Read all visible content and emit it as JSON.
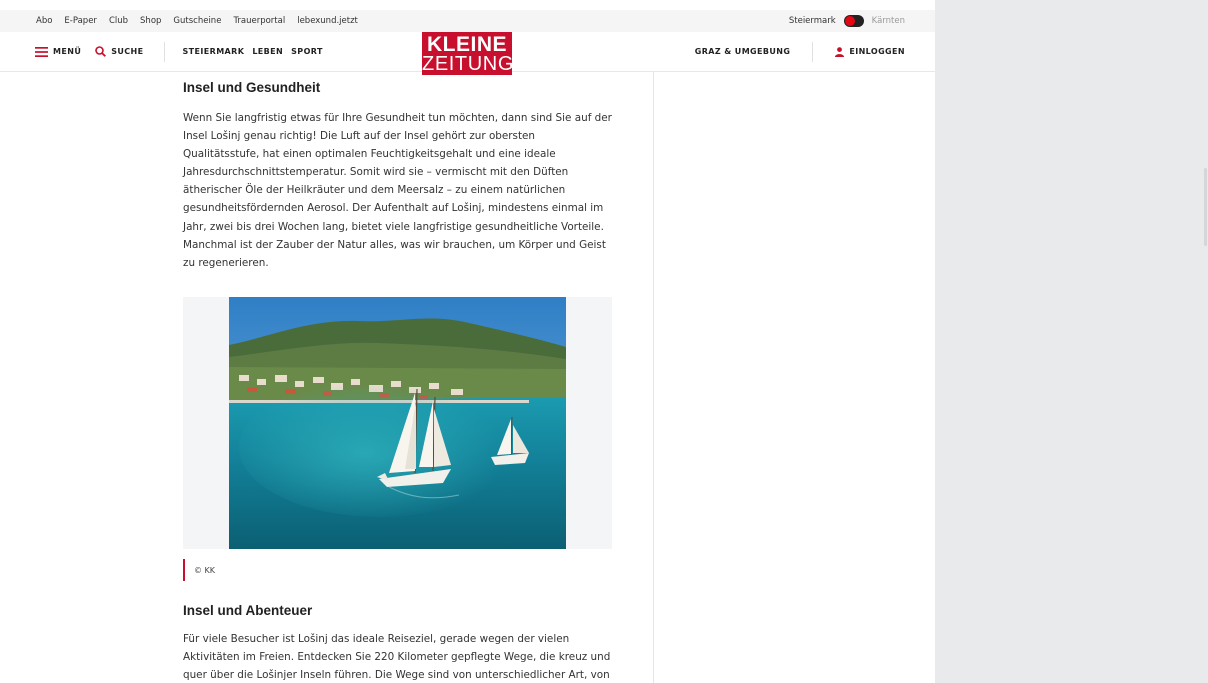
{
  "topbar": {
    "links": [
      "Abo",
      "E-Paper",
      "Club",
      "Shop",
      "Gutscheine",
      "Trauerportal",
      "lebexund.jetzt"
    ],
    "region_active": "Steiermark",
    "region_inactive": "Kärnten"
  },
  "nav": {
    "menu_label": "MENÜ",
    "search_label": "SUCHE",
    "sections": [
      "STEIERMARK",
      "LEBEN",
      "SPORT"
    ],
    "local_label": "GRAZ & UMGEBUNG",
    "login_label": "EINLOGGEN"
  },
  "logo": {
    "line1": "KLEINE",
    "line2": "ZEITUNG",
    "color": "#c8102e"
  },
  "article": {
    "section1_heading": "Insel und Gesundheit",
    "section1_text": "Wenn Sie langfristig etwas für Ihre Gesundheit tun möchten, dann sind Sie auf der Insel Lošinj genau richtig! Die Luft auf der Insel gehört zur obersten Qualitätsstufe, hat einen optimalen Feuchtigkeitsgehalt und eine ideale Jahresdurchschnittstemperatur. Somit wird sie – vermischt mit den Düften ätherischer Öle der Heilkräuter und dem Meersalz – zu einem natürlichen gesundheitsfördernden Aerosol. Der Aufenthalt auf Lošinj, mindestens einmal im Jahr, zwei bis drei Wochen lang, bietet viele langfristige gesundheitliche Vorteile. Manchmal ist der Zauber der Natur alles, was wir brauchen, um Körper und Geist zu regenerieren.",
    "image_caption": "© KK",
    "section2_heading": "Insel und Abenteuer",
    "section2_text": "Für viele Besucher ist Lošinj das ideale Reiseziel, gerade wegen der vielen Aktivitäten im Freien. Entdecken Sie 220 Kilometer gepflegte Wege, die kreuz und quer über die Lošinjer Inseln führen. Die Wege sind von unterschiedlicher Art, von"
  },
  "colors": {
    "accent": "#c8102e",
    "text": "#333333",
    "gutter": "#e9eaec"
  }
}
